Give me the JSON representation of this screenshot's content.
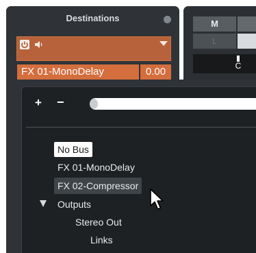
{
  "destinations": {
    "title": "Destinations",
    "selected_name": "FX 01-MonoDelay",
    "selected_value": "0.00",
    "icons": [
      "power-icon",
      "speaker-icon",
      "dropdown-arrow-icon"
    ],
    "accent_color": "#d46e3d"
  },
  "mixer": {
    "mute_label": "M",
    "left_label": "L",
    "pan_label": "C"
  },
  "popup": {
    "add_label": "+",
    "remove_label": "−",
    "search_value": "",
    "items": [
      {
        "label": "No Bus",
        "state": "selected"
      },
      {
        "label": "FX 01-MonoDelay",
        "state": "normal"
      },
      {
        "label": "FX 02-Compressor",
        "state": "hovered"
      }
    ],
    "outputs_group": {
      "label": "Outputs",
      "expanded": true,
      "children": [
        {
          "label": "Stereo Out"
        },
        {
          "label": "Links"
        }
      ]
    }
  }
}
